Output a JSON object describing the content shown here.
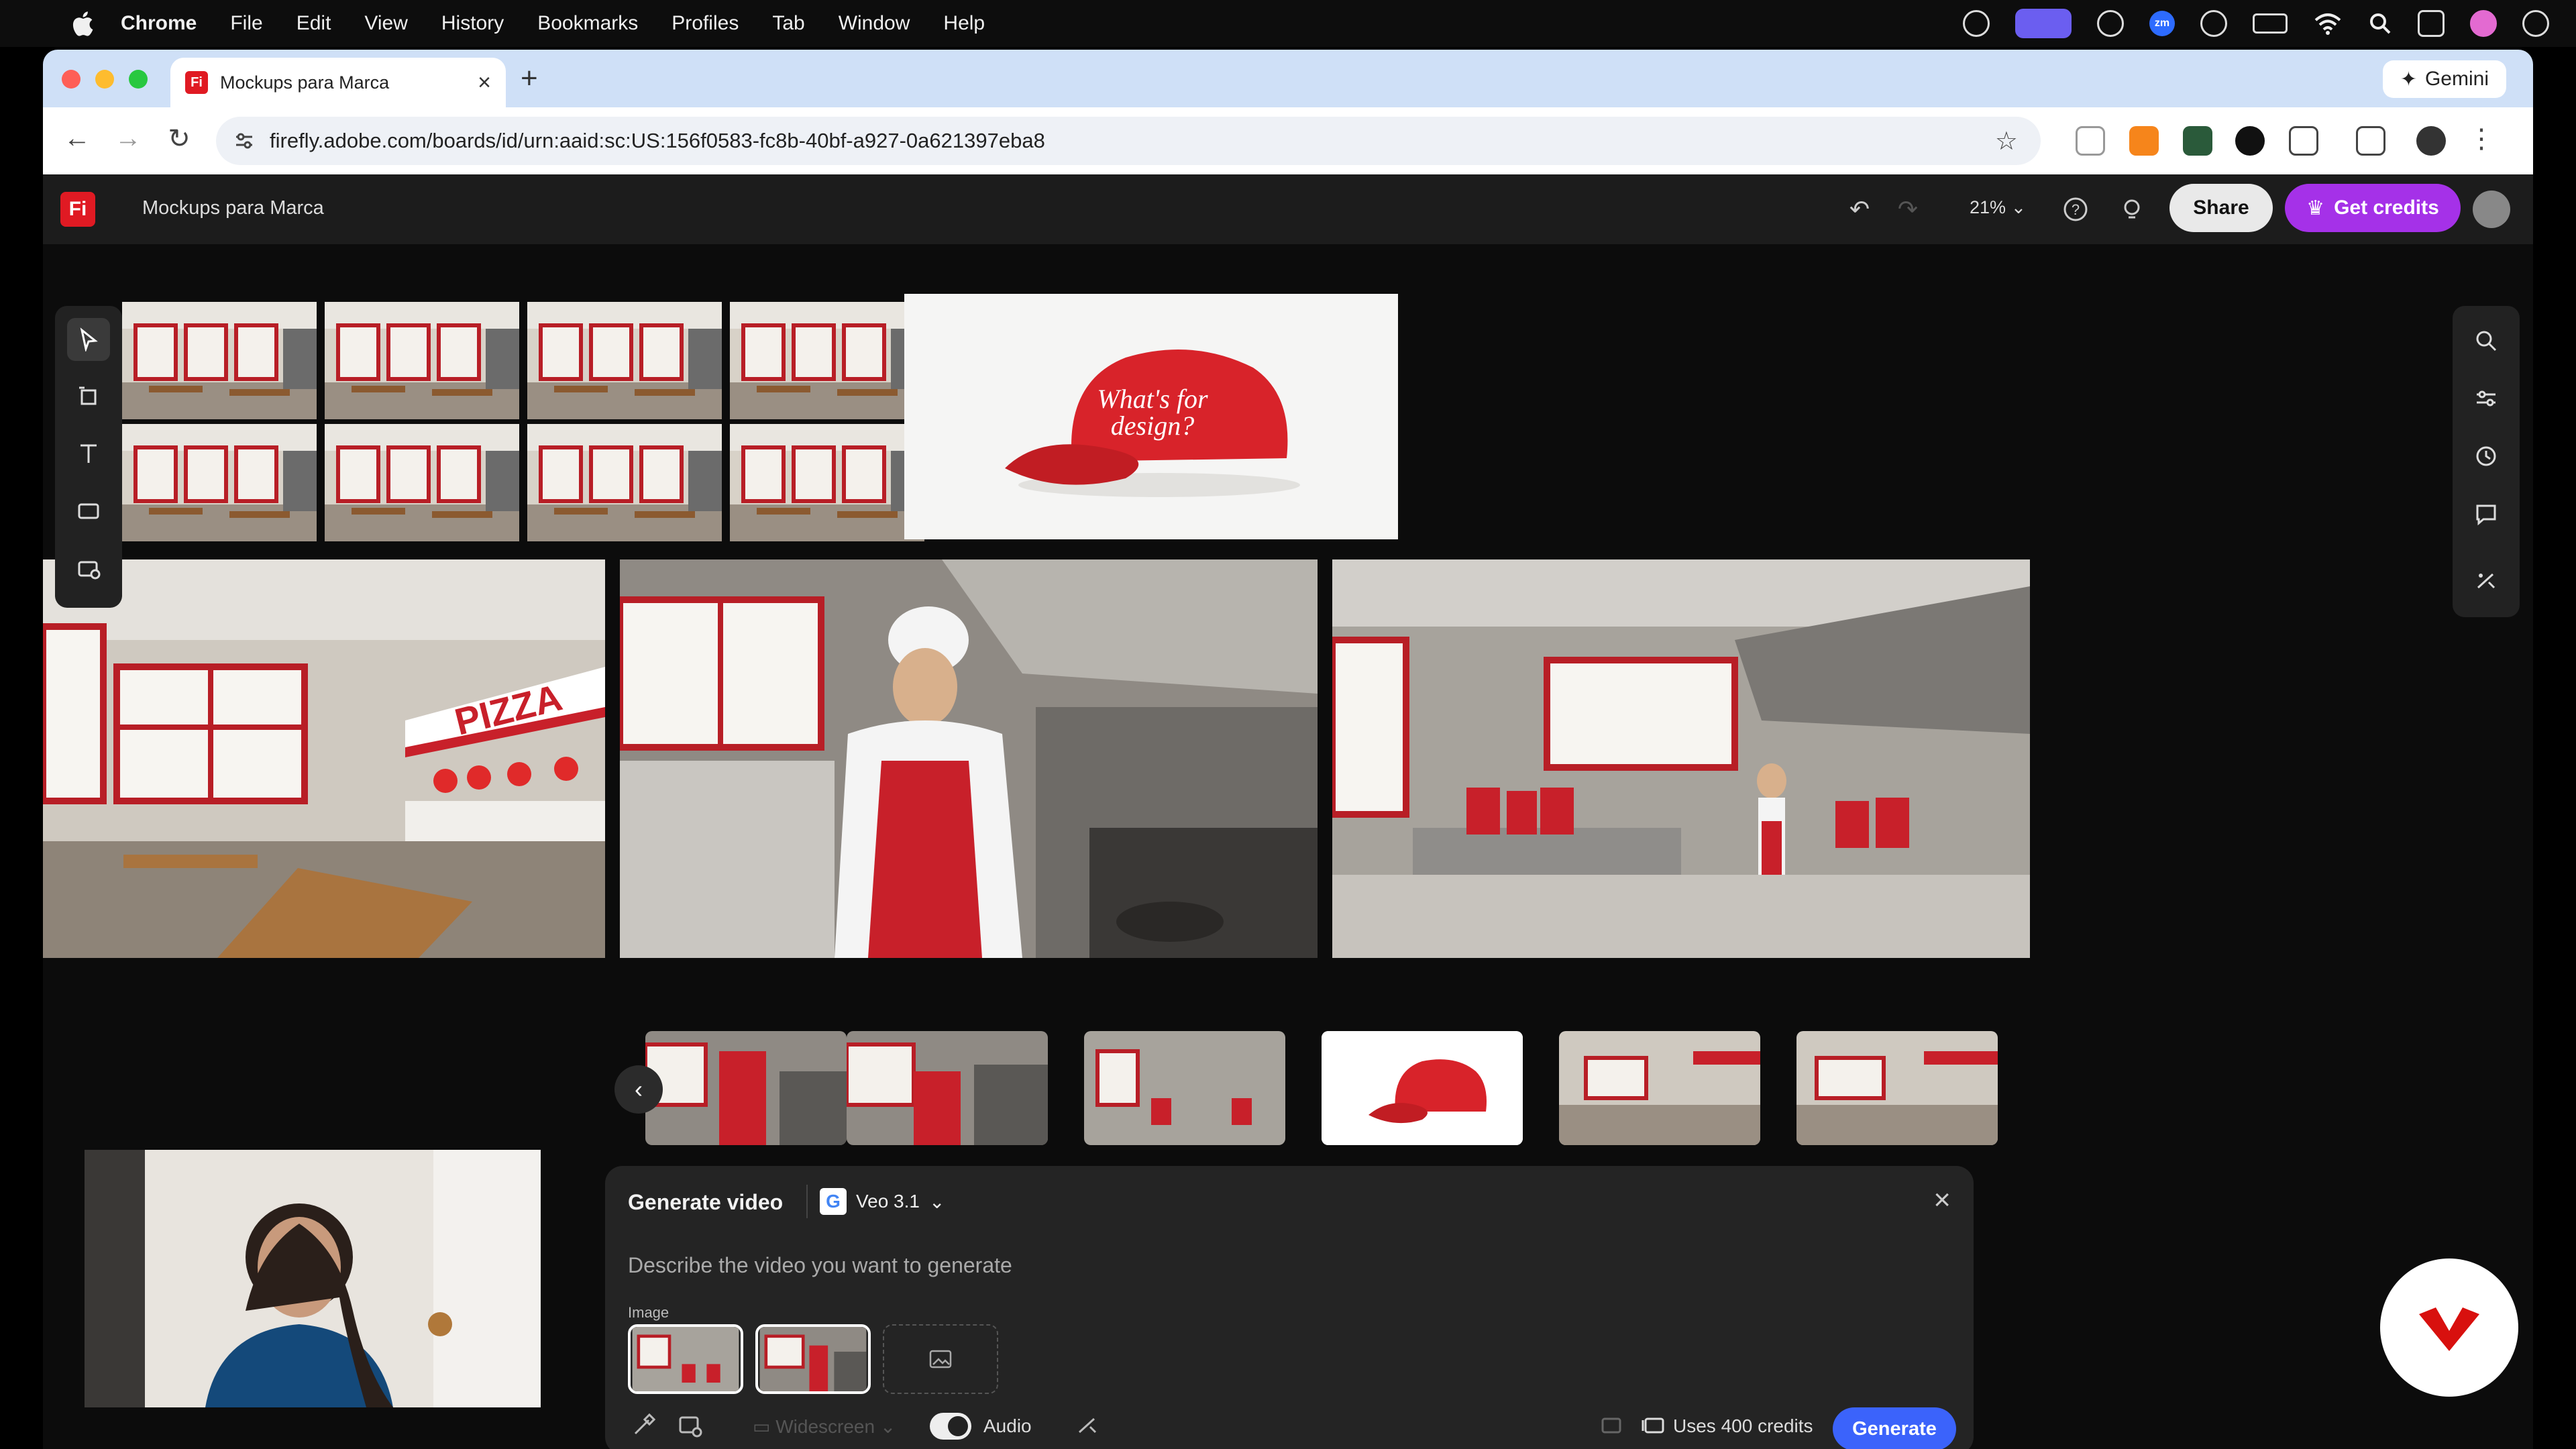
{
  "menubar": {
    "items": [
      "Chrome",
      "File",
      "Edit",
      "View",
      "History",
      "Bookmarks",
      "Profiles",
      "Tab",
      "Window",
      "Help"
    ]
  },
  "browser": {
    "tab_title": "Mockups para Marca",
    "tab_badge": "Fi",
    "new_tab": "+",
    "gemini_label": "Gemini",
    "url": "firefly.adobe.com/boards/id/urn:aaid:sc:US:156f0583-fc8b-40bf-a927-0a621397eba8"
  },
  "app": {
    "logo": "Fi",
    "title": "Mockups para Marca",
    "zoom": "21%",
    "share_label": "Share",
    "credits_label": "Get credits",
    "cap_text_line1": "What's for",
    "cap_text_line2": "design?",
    "pizza_sign": "PIZZA"
  },
  "panel": {
    "title": "Generate video",
    "model": "Veo 3.1",
    "model_logo": "G",
    "prompt_placeholder": "Describe the video you want to generate",
    "image_label": "Image",
    "widescreen_label": "Widescreen",
    "audio_label": "Audio",
    "credits_info": "Uses 400 credits",
    "generate_label": "Generate"
  },
  "colors": {
    "accent_purple": "#a531e8",
    "generate_blue": "#3b63fb",
    "firefly_red": "#e01a23",
    "brand_red": "#c8202a"
  }
}
